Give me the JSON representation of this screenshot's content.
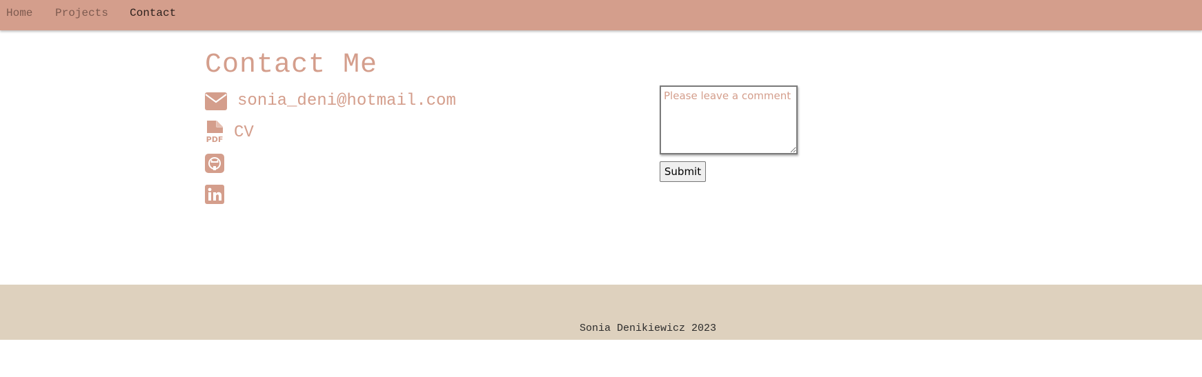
{
  "nav": {
    "items": [
      {
        "label": "Home",
        "active": false
      },
      {
        "label": "Projects",
        "active": false
      },
      {
        "label": "Contact",
        "active": true
      }
    ]
  },
  "main": {
    "title": "Contact Me",
    "contacts": {
      "email": {
        "icon": "envelope-icon",
        "text": "sonia_deni@hotmail.com"
      },
      "cv": {
        "icon": "file-pdf-icon",
        "text": "CV"
      },
      "github": {
        "icon": "github-icon"
      },
      "linkedin": {
        "icon": "linkedin-icon"
      }
    }
  },
  "form": {
    "comment_placeholder": "Please leave a comment",
    "comment_value": "",
    "submit_label": "Submit"
  },
  "footer": {
    "text": "Sonia Denikiewicz 2023"
  },
  "colors": {
    "navbar": "#d49e8c",
    "accent": "#d49e8c",
    "footer": "#ded1be"
  }
}
